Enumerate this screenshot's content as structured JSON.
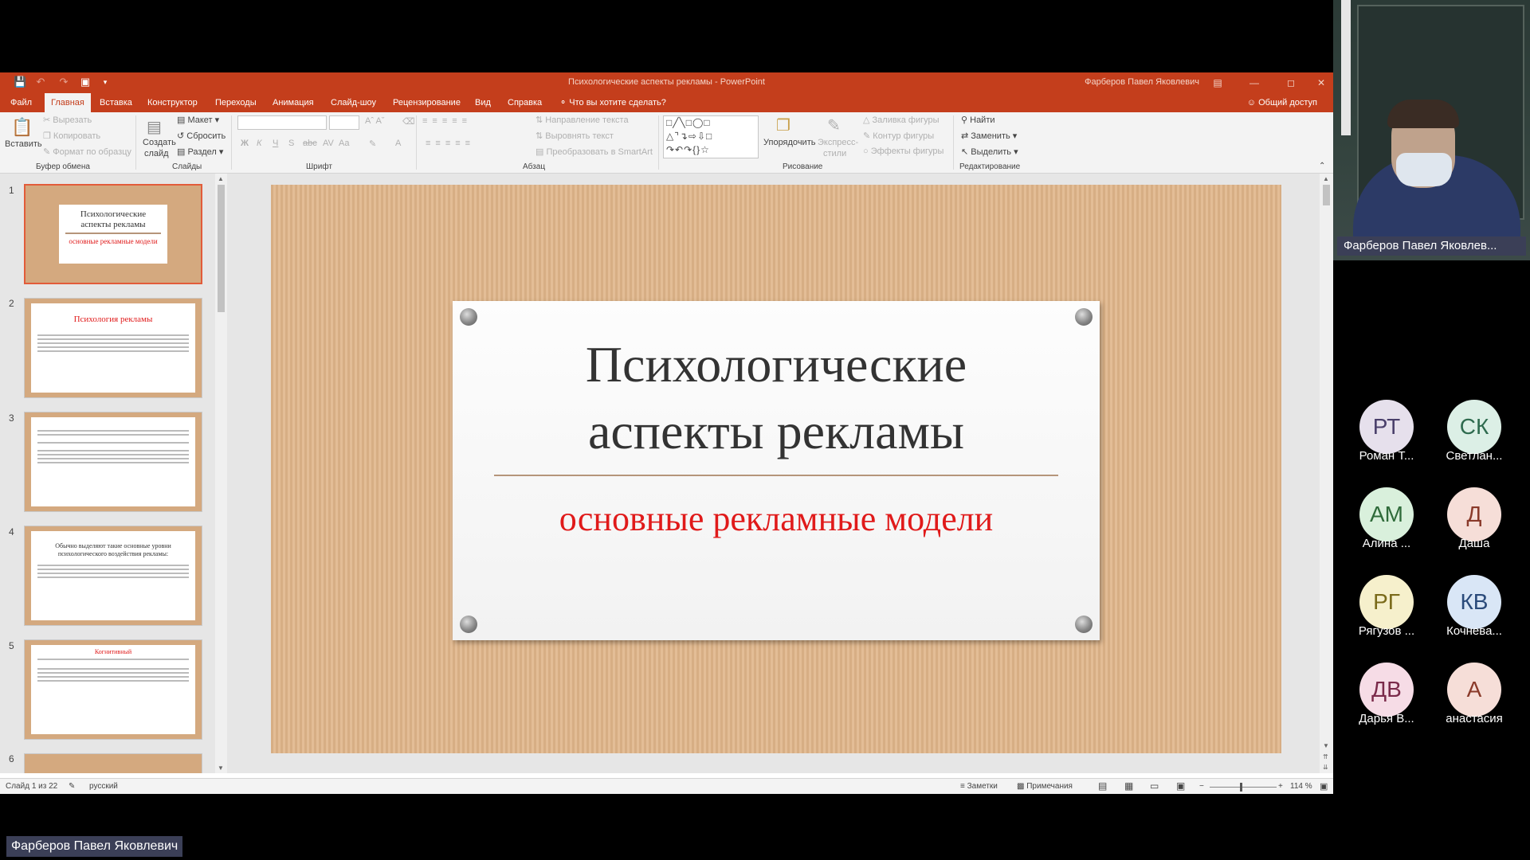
{
  "window": {
    "title": "Психологические аспекты рекламы - PowerPoint",
    "user": "Фарберов Павел Яковлевич"
  },
  "tabs": [
    "Файл",
    "Главная",
    "Вставка",
    "Конструктор",
    "Переходы",
    "Анимация",
    "Слайд-шоу",
    "Рецензирование",
    "Вид",
    "Справка"
  ],
  "tell_me": "Что вы хотите сделать?",
  "share": "Общий доступ",
  "ribbon": {
    "clipboard": {
      "paste": "Вставить",
      "cut": "Вырезать",
      "copy": "Копировать",
      "format": "Формат по образцу",
      "label": "Буфер обмена"
    },
    "slides": {
      "new_line1": "Создать",
      "new_line2": "слайд",
      "layout": "Макет",
      "reset": "Сбросить",
      "section": "Раздел",
      "label": "Слайды"
    },
    "font": {
      "label": "Шрифт",
      "bold": "Ж",
      "italic": "К",
      "underline": "Ч",
      "shadow": "S"
    },
    "paragraph": {
      "text_direction": "Направление текста",
      "align_text": "Выровнять текст",
      "smartart": "Преобразовать в SmartArt",
      "label": "Абзац"
    },
    "drawing": {
      "arrange": "Упорядочить",
      "quick_styles_1": "Экспресс-",
      "quick_styles_2": "стили",
      "fill": "Заливка фигуры",
      "outline": "Контур фигуры",
      "effects": "Эффекты фигуры",
      "label": "Рисование"
    },
    "editing": {
      "find": "Найти",
      "replace": "Заменить",
      "select": "Выделить",
      "label": "Редактирование"
    }
  },
  "thumbnails": [
    {
      "num": "1",
      "title": "Психологические аспекты рекламы",
      "subtitle": "основные рекламные модели"
    },
    {
      "num": "2",
      "title": "Психология рекламы"
    },
    {
      "num": "3"
    },
    {
      "num": "4",
      "title": "Обычно выделяют такие основные уровни психологического воздействия рекламы:"
    },
    {
      "num": "5",
      "title": "Когнитивный"
    },
    {
      "num": "6"
    }
  ],
  "slide": {
    "title_line1": "Психологические",
    "title_line2": "аспекты рекламы",
    "subtitle": "основные рекламные модели"
  },
  "status": {
    "slide_counter": "Слайд 1 из 22",
    "language": "русский",
    "notes": "Заметки",
    "comments": "Примечания",
    "zoom": "114 %"
  },
  "meeting": {
    "presenter_label": "Фарберов Павел Яковлев...",
    "bottom_name": "Фарберов Павел Яковлевич",
    "participants": [
      {
        "initials": "РТ",
        "name": "Роман Т...",
        "bg": "#e6e0ec",
        "fg": "#4a3f6b"
      },
      {
        "initials": "СК",
        "name": "Светлан...",
        "bg": "#dcefe6",
        "fg": "#2f6b4f"
      },
      {
        "initials": "АМ",
        "name": "Алина ...",
        "bg": "#d9f0dc",
        "fg": "#2f6b3a"
      },
      {
        "initials": "Д",
        "name": "Даша",
        "bg": "#f6ded8",
        "fg": "#8a3a2a"
      },
      {
        "initials": "РГ",
        "name": "Рягузов ...",
        "bg": "#f6f0cc",
        "fg": "#7a6a1a"
      },
      {
        "initials": "КВ",
        "name": "Кочнева...",
        "bg": "#d9e6f6",
        "fg": "#2a4a7a"
      },
      {
        "initials": "ДВ",
        "name": "Дарья В...",
        "bg": "#f6dce6",
        "fg": "#7a2a4a"
      },
      {
        "initials": "А",
        "name": "анастасия",
        "bg": "#f6ded8",
        "fg": "#8a3a2a"
      }
    ]
  }
}
